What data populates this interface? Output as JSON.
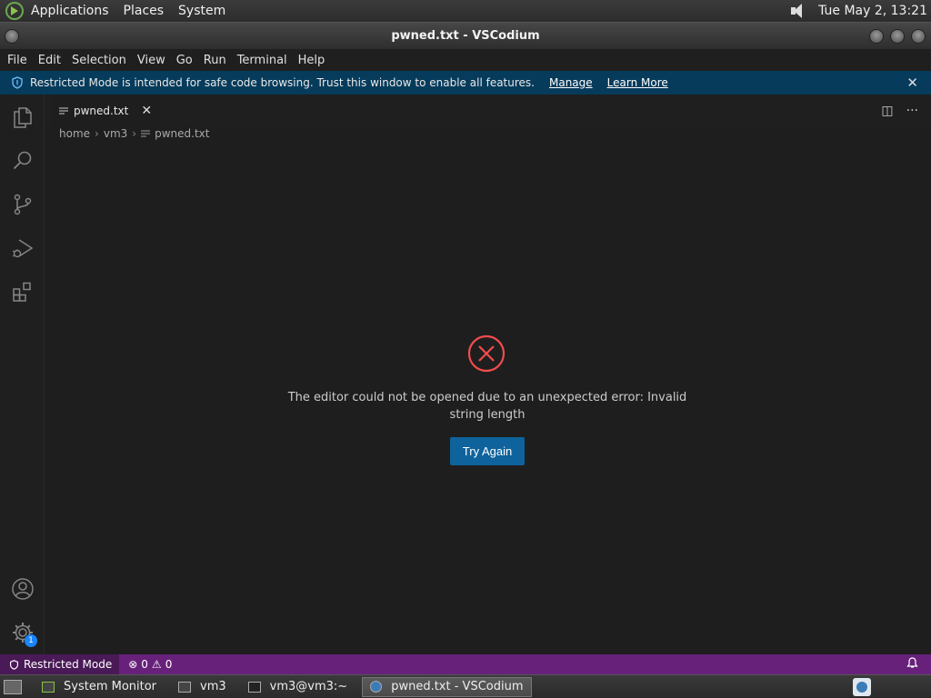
{
  "system_panel": {
    "menus": [
      "Applications",
      "Places",
      "System"
    ],
    "clock": "Tue May  2, 13:21"
  },
  "window": {
    "title": "pwned.txt - VSCodium"
  },
  "menubar": [
    "File",
    "Edit",
    "Selection",
    "View",
    "Go",
    "Run",
    "Terminal",
    "Help"
  ],
  "banner": {
    "message": "Restricted Mode is intended for safe code browsing. Trust this window to enable all features.",
    "manage": "Manage",
    "learn_more": "Learn More",
    "close": "✕"
  },
  "tab": {
    "label": "pwned.txt",
    "close": "✕"
  },
  "editor_actions": {
    "split": "◫",
    "more": "···"
  },
  "breadcrumb": [
    "home",
    "vm3",
    "pwned.txt"
  ],
  "error": {
    "message": "The editor could not be opened due to an unexpected error: Invalid string length",
    "button": "Try Again"
  },
  "activity": {
    "settings_badge": "1"
  },
  "statusbar": {
    "restricted": "Restricted Mode",
    "errors": "0",
    "warnings": "0",
    "error_icon": "⊗",
    "warning_icon": "⚠",
    "bell": "🔔"
  },
  "taskbar": [
    {
      "label": "System Monitor"
    },
    {
      "label": "vm3"
    },
    {
      "label": "vm3@vm3:~"
    },
    {
      "label": "pwned.txt - VSCodium",
      "active": true
    }
  ],
  "colors": {
    "statusbar": "#68217a",
    "banner": "#063b5b",
    "button": "#0e639c",
    "error": "#f14c4c"
  }
}
